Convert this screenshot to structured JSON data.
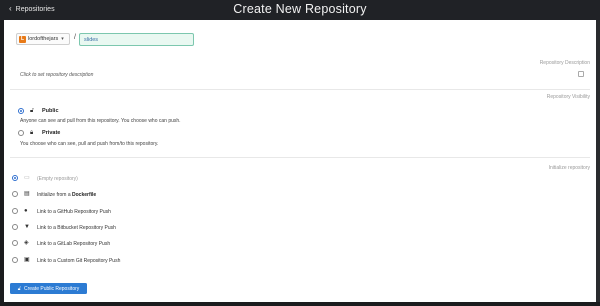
{
  "header": {
    "back_label": "Repositories",
    "title": "Create New Repository"
  },
  "namespace": {
    "avatar_letter": "L",
    "selected": "lordofthejars"
  },
  "repo_name": {
    "value": "slides"
  },
  "description": {
    "section_label": "Repository Description",
    "placeholder": "Click to set repository description"
  },
  "visibility": {
    "section_label": "Repository Visibility",
    "options": [
      {
        "title": "Public",
        "description": "Anyone can see and pull from this repository. You choose who can push.",
        "selected": true
      },
      {
        "title": "Private",
        "description": "You choose who can see, pull and push from/to this repository.",
        "selected": false
      }
    ]
  },
  "initialize": {
    "section_label": "Initialize repository",
    "options": [
      {
        "label": "(Empty repository)",
        "icon": "inbox-icon",
        "selected": true
      },
      {
        "label_prefix": "Initialize from a ",
        "label_bold": "Dockerfile",
        "icon": "file-icon",
        "selected": false
      },
      {
        "label": "Link to a GitHub Repository Push",
        "icon": "github-icon",
        "selected": false
      },
      {
        "label": "Link to a Bitbucket Repository Push",
        "icon": "bitbucket-icon",
        "selected": false
      },
      {
        "label": "Link to a GitLab Repository Push",
        "icon": "gitlab-icon",
        "selected": false
      },
      {
        "label": "Link to a Custom Git Repository Push",
        "icon": "git-icon",
        "selected": false
      }
    ]
  },
  "create_button": {
    "label": "Create Public Repository"
  },
  "colors": {
    "accent": "#2c7bd3",
    "header_bg": "#202226",
    "input_bg": "#e9f8f1",
    "avatar": "#e87a18"
  }
}
